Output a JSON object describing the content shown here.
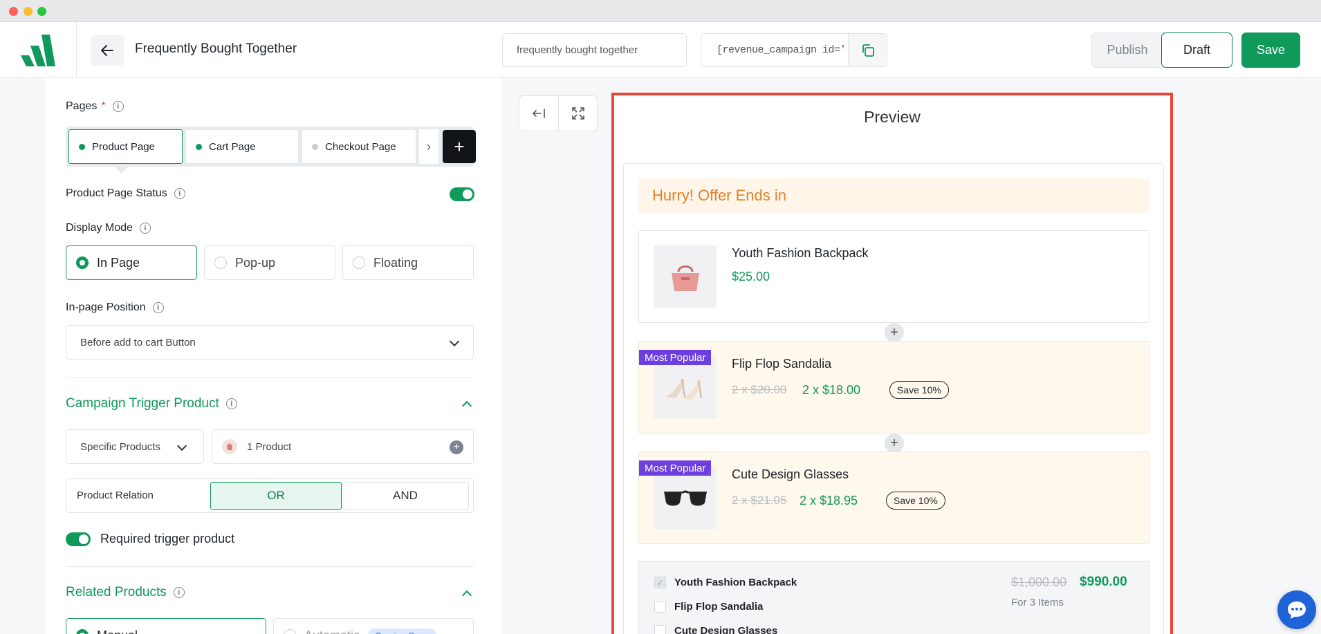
{
  "header": {
    "title": "Frequently Bought Together",
    "campaign_name": "frequently bought together",
    "shortcode": "[revenue_campaign id='",
    "publish_label": "Publish",
    "draft_label": "Draft",
    "save_label": "Save"
  },
  "settings": {
    "pages_label": "Pages",
    "pages_required_mark": "*",
    "page_tabs": [
      {
        "label": "Product Page",
        "active": true
      },
      {
        "label": "Cart Page",
        "active": false
      },
      {
        "label": "Checkout Page",
        "active": false
      }
    ],
    "page_status_label": "Product Page Status",
    "display_mode_label": "Display Mode",
    "display_modes": [
      "In Page",
      "Pop-up",
      "Floating"
    ],
    "inpage_position_label": "In-page Position",
    "inpage_position_value": "Before add to cart Button",
    "trigger_section_title": "Campaign Trigger Product",
    "trigger_type_value": "Specific Products",
    "trigger_products_value": "1 Product",
    "relation_label": "Product Relation",
    "relation_or": "OR",
    "relation_and": "AND",
    "required_trigger_label": "Required trigger product",
    "related_section_title": "Related Products",
    "related_modes": [
      "Manual",
      "Automatic"
    ],
    "coming_soon_label": "Coming Soon"
  },
  "preview": {
    "title": "Preview",
    "offer_text": "Hurry! Offer Ends in",
    "products": [
      {
        "name": "Youth Fashion Backpack",
        "price": "$25.00"
      },
      {
        "name": "Flip Flop Sandalia",
        "badge": "Most Popular",
        "old_price": "2 x $20.00",
        "new_price": "2 x $18.00",
        "save": "Save 10%"
      },
      {
        "name": "Cute Design Glasses",
        "badge": "Most Popular",
        "old_price": "2 x $21.05",
        "new_price": "2 x $18.95",
        "save": "Save 10%"
      }
    ],
    "summary": {
      "items": [
        "Youth Fashion Backpack",
        "Flip Flop Sandalia",
        "Cute Design Glasses"
      ],
      "old_total": "$1,000.00",
      "new_total": "$990.00",
      "count": "For 3 Items"
    }
  },
  "colors": {
    "accent": "#0f9a5b",
    "badge": "#6d3fe0",
    "offer": "#e0822d",
    "highlight": "#e8473a"
  }
}
